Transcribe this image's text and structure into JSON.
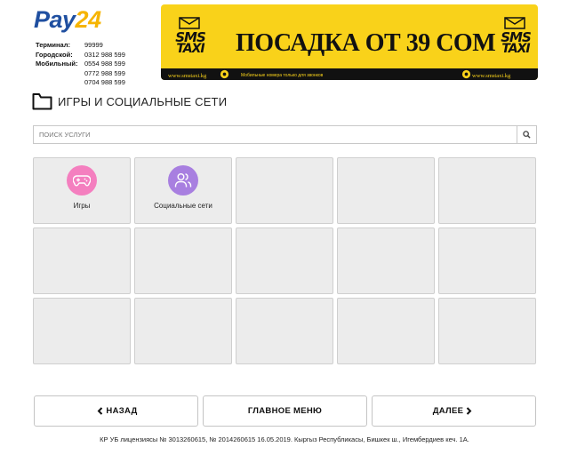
{
  "logo": {
    "part1": "Pay",
    "part2": "24"
  },
  "terminal_info": [
    {
      "label": "Терминал:",
      "value": "99999"
    },
    {
      "label": "Городской:",
      "value": "0312 988 599"
    },
    {
      "label": "Мобильный:",
      "value": "0554 988 599"
    },
    {
      "label": "",
      "value": "0772 988 599"
    },
    {
      "label": "",
      "value": "0704 988 599"
    }
  ],
  "banner": {
    "headline": "ПОСАДКА ОТ 39 СОМ",
    "badge_line1": "SMS",
    "badge_line2": "TAXI",
    "site": "www.smstaxi.kg",
    "fine_print": "Мобильные номера только для звонков",
    "colors": {
      "background": "#f9d21a",
      "strip": "#111111"
    }
  },
  "category": {
    "icon": "folder-icon",
    "title": "ИГРЫ И СОЦИАЛЬНЫЕ СЕТИ"
  },
  "search": {
    "placeholder": "ПОИСК УСЛУГИ",
    "value": "",
    "icon": "search-icon"
  },
  "services": [
    {
      "name": "Игры",
      "icon": "gamepad-icon",
      "color": "#f47fbf"
    },
    {
      "name": "Социальные сети",
      "icon": "users-icon",
      "color": "#a87fe0"
    }
  ],
  "navigation": {
    "back": "НАЗАД",
    "main_menu": "ГЛАВНОЕ МЕНЮ",
    "next": "ДАЛЕЕ"
  },
  "footer": "КР УБ лицензиясы № 3013260615, № 2014260615 16.05.2019. Кыргыз Республикасы, Бишкек ш., Игембердиев кеч. 1А."
}
